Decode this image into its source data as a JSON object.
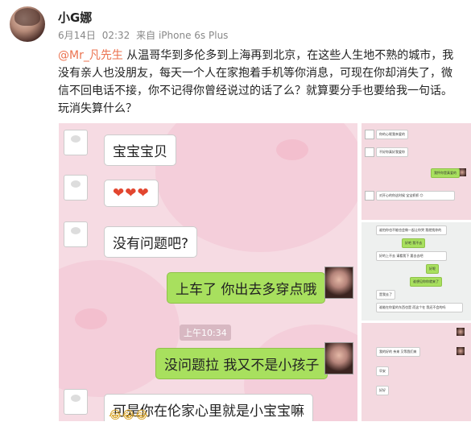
{
  "post": {
    "username": "小G娜",
    "date": "6月14日",
    "time": "02:32",
    "source": "来自 iPhone 6s Plus",
    "mention": "@Mr_凡先生",
    "text": " 从温哥华到多伦多到上海再到北京，在这些人生地不熟的城市，我没有亲人也没朋友，每天一个人在家抱着手机等你消息，可现在你却消失了，微信不回电话不接，你不记得你曾经说过的话了么？就算要分手也要给我一句话。玩消失算什么？"
  },
  "chat": {
    "contact_label": "",
    "messages": [
      {
        "side": "left",
        "text": "宝宝宝贝"
      },
      {
        "side": "left",
        "text": "❤❤❤"
      },
      {
        "side": "left",
        "text": "没有问题吧?"
      },
      {
        "side": "right",
        "text": "上车了 你出去多穿点哦"
      },
      {
        "side": "right",
        "text": "没问题拉 我又不是小孩子"
      },
      {
        "side": "left",
        "text": "可是你在伦家心里就是小宝宝嘛"
      }
    ],
    "timestamp": "上午10:34",
    "emoji_row": "😂😂😂"
  },
  "thumbnails": {
    "thumb1": [
      "你的心呢我亲爱的",
      "不好你真好我爱你",
      "我怀你是真爱的",
      "对开心的你这时候 宝宝抓抓 😊"
    ],
    "thumb2": [
      "谁怕你也不能也会做一起让你哭 我就找你的",
      "好吧 我不去",
      "好的上不去 请看我下 要去去吧",
      "好呢",
      "谁想见你你就来了",
      "是我去了",
      "谁能在你爱的东西也是 而这个在 我还不会的吗"
    ],
    "thumb3": [
      "我的好的 亲来 又等我们来",
      "早安",
      "好好"
    ]
  },
  "colors": {
    "mention": "#eb7350",
    "bubble_green": "#a8e05e",
    "chat_bg": "#f6dbe3"
  }
}
